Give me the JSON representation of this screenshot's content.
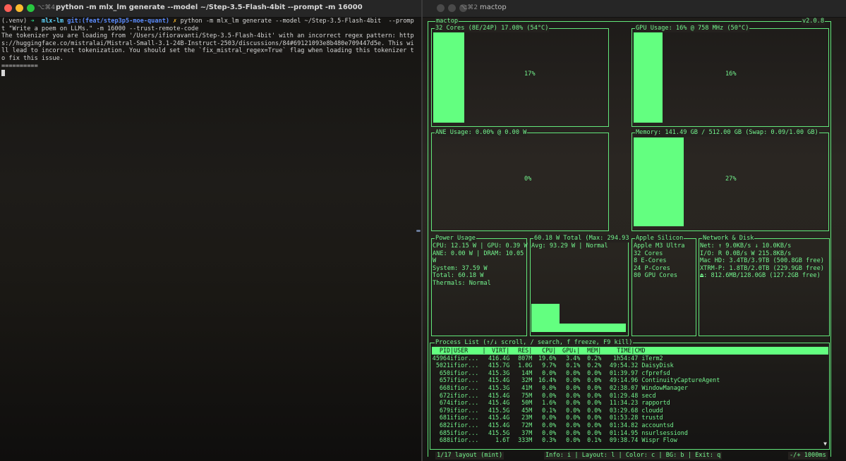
{
  "left": {
    "kbd": "⌥⌘4",
    "title": "python -m mlx_lm generate --model ~/Step-3.5-Flash-4bit --prompt  -m 16000",
    "prompt_venv": "(.venv)",
    "prompt_arrow": "➜",
    "prompt_dir": "mlx-lm",
    "prompt_git": "git:(feat/step3p5-moe-quant)",
    "prompt_x": "✗",
    "cmd": "python -m mlx_lm generate --model ~/Step-3.5-Flash-4bit  --prompt \"Write a poem on LLMs.\" -m 16000 --trust-remote-code",
    "output": "The tokenizer you are loading from '/Users/ifioravanti/Step-3.5-Flash-4bit' with an incorrect regex pattern: https://huggingface.co/mistralai/Mistral-Small-3.1-24B-Instruct-2503/discussions/84#69121093e8b480e709447d5e. This will lead to incorrect tokenization. You should set the `fix_mistral_regex=True` flag when loading this tokenizer to fix this issue.",
    "separator": "=========="
  },
  "right": {
    "kbd": "⌥⌘2",
    "title": "mactop",
    "app_name": "mactop",
    "version": "v2.0.8",
    "cpu": {
      "label": "32 Cores (8E/24P) 17.08% (54°C)",
      "pct": "17%",
      "level": 17
    },
    "gpu": {
      "label": "GPU Usage: 16% @ 758 MHz (50°C)",
      "pct": "16%",
      "level": 16
    },
    "ane": {
      "label": "ANE Usage: 0.00% @ 0.00 W",
      "pct": "0%",
      "level": 0
    },
    "mem": {
      "label": "Memory: 141.49 GB / 512.00 GB (Swap: 0.09/1.00 GB)",
      "pct": "27%",
      "level": 27
    },
    "power": {
      "label": "Power Usage",
      "lines": [
        "CPU: 12.15 W | GPU: 0.39 W",
        "ANE: 0.00 W | DRAM: 10.05",
        "W",
        "System: 37.59 W",
        "Total: 60.18 W",
        "Thermals: Normal"
      ]
    },
    "total": {
      "label": "60.18 W Total (Max: 294.93",
      "line": "Avg: 93.29 W | Normal",
      "levels": [
        0.28,
        0.08
      ]
    },
    "silicon": {
      "label": "Apple Silicon",
      "lines": [
        "Apple M3 Ultra",
        "32 Cores",
        "8 E-Cores",
        "24 P-Cores",
        "80 GPU Cores"
      ]
    },
    "net": {
      "label": "Network & Disk",
      "lines": [
        "Net: ↑ 9.0KB/s ↓ 10.0KB/s",
        "I/O: R 0.0B/s W 215.8KB/s",
        "Mac HD: 3.4TB/3.9TB (500.8GB free)",
        "XTRM-P: 1.8TB/2.0TB (229.9GB free)",
        "⏏: 812.6MB/128.0GB (127.2GB free)"
      ]
    },
    "process": {
      "label": "Process List (↑/↓ scroll, / search, f freeze, F9 kill)",
      "headers": [
        "PID",
        "|USER",
        "|",
        "VIRT|",
        "RES|",
        "CPU|",
        "GPU↓|",
        "MEM|",
        "TIME|CMD"
      ],
      "rows": [
        [
          "45964",
          "ifior...",
          "416.4G",
          "807M",
          "19.6%",
          "3.4%",
          "0.2%",
          "1h54:47",
          "iTerm2"
        ],
        [
          "5021",
          "ifior...",
          "415.7G",
          "1.0G",
          "9.7%",
          "0.1%",
          "0.2%",
          "49:54.32",
          "DaisyDisk"
        ],
        [
          "650",
          "ifior...",
          "415.3G",
          "14M",
          "0.0%",
          "0.0%",
          "0.0%",
          "01:39.97",
          "cfprefsd"
        ],
        [
          "657",
          "ifior...",
          "415.4G",
          "32M",
          "16.4%",
          "0.0%",
          "0.0%",
          "49:14.96",
          "ContinuityCaptureAgent"
        ],
        [
          "668",
          "ifior...",
          "415.3G",
          "41M",
          "0.0%",
          "0.0%",
          "0.0%",
          "02:38.07",
          "WindowManager"
        ],
        [
          "672",
          "ifior...",
          "415.4G",
          "75M",
          "0.0%",
          "0.0%",
          "0.0%",
          "01:29.48",
          "secd"
        ],
        [
          "674",
          "ifior...",
          "415.4G",
          "50M",
          "1.6%",
          "0.0%",
          "0.0%",
          "11:34.23",
          "rapportd"
        ],
        [
          "679",
          "ifior...",
          "415.5G",
          "45M",
          "0.1%",
          "0.0%",
          "0.0%",
          "03:29.68",
          "cloudd"
        ],
        [
          "681",
          "ifior...",
          "415.4G",
          "23M",
          "0.0%",
          "0.0%",
          "0.0%",
          "01:53.28",
          "trustd"
        ],
        [
          "682",
          "ifior...",
          "415.4G",
          "72M",
          "0.0%",
          "0.0%",
          "0.0%",
          "01:34.82",
          "accountsd"
        ],
        [
          "685",
          "ifior...",
          "415.5G",
          "37M",
          "0.0%",
          "0.0%",
          "0.0%",
          "01:14.95",
          "nsurlsessiond"
        ],
        [
          "688",
          "ifior...",
          "1.6T",
          "333M",
          "0.3%",
          "0.0%",
          "0.1%",
          "09:38.74",
          "Wispr Flow"
        ]
      ],
      "scroll_indicator": "▼"
    },
    "footer_left": "1/17 layout (mint)",
    "footer_mid": "Info: i | Layout: l | Color: c | BG: b | Exit: q",
    "footer_right": "-/+ 1000ms"
  },
  "colors": {
    "accent": "#74f58e",
    "bar": "#63ff80",
    "red": "#ff5f57",
    "yellow": "#febc2e",
    "green": "#28c840",
    "git": "#e06c75",
    "dir": "#5fd7ff"
  }
}
